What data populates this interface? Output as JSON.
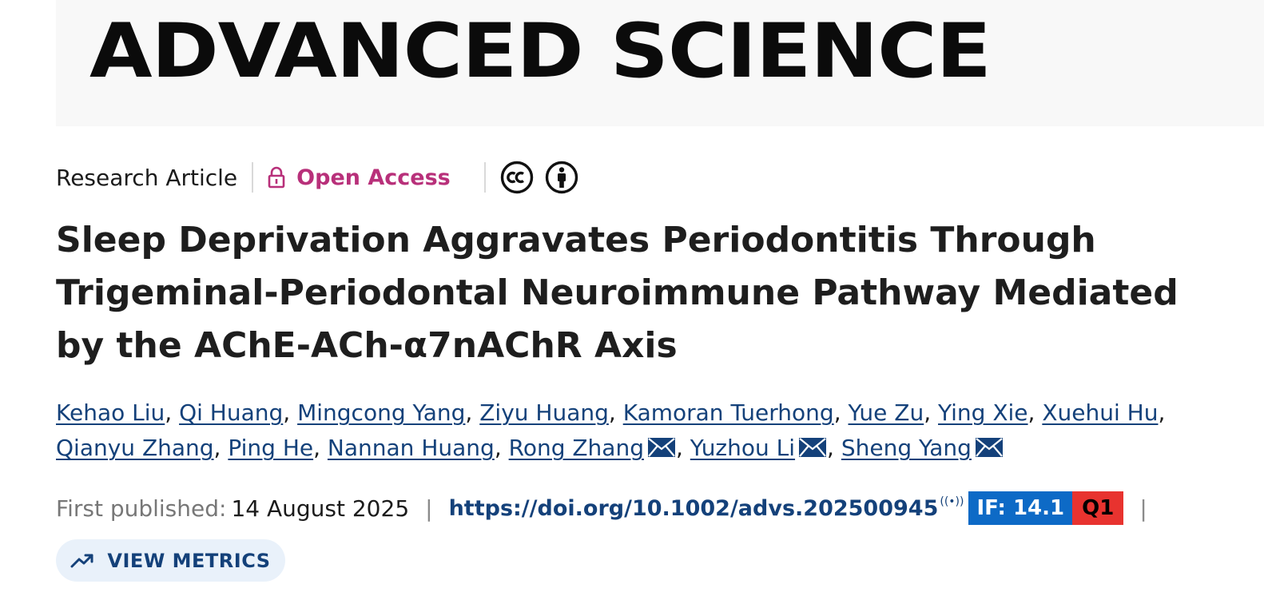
{
  "journal": {
    "name": "ADVANCED SCIENCE"
  },
  "meta": {
    "article_type": "Research Article",
    "access_label": "Open Access",
    "icons": [
      "lock-icon",
      "cc-icon",
      "cc-by-icon"
    ]
  },
  "title": "Sleep Deprivation Aggravates Periodontitis Through Trigeminal-Periodontal Neuroimmune Pathway Mediated by the AChE-ACh-α7nAChR Axis",
  "authors": [
    {
      "name": "Kehao Liu",
      "corresponding": false
    },
    {
      "name": "Qi Huang",
      "corresponding": false
    },
    {
      "name": "Mingcong Yang",
      "corresponding": false
    },
    {
      "name": "Ziyu Huang",
      "corresponding": false
    },
    {
      "name": "Kamoran Tuerhong",
      "corresponding": false
    },
    {
      "name": "Yue Zu",
      "corresponding": false
    },
    {
      "name": "Ying Xie",
      "corresponding": false
    },
    {
      "name": "Xuehui Hu",
      "corresponding": false
    },
    {
      "name": "Qianyu Zhang",
      "corresponding": false
    },
    {
      "name": "Ping He",
      "corresponding": false
    },
    {
      "name": "Nannan Huang",
      "corresponding": false
    },
    {
      "name": "Rong Zhang",
      "corresponding": true
    },
    {
      "name": "Yuzhou Li",
      "corresponding": true
    },
    {
      "name": "Sheng Yang",
      "corresponding": true
    }
  ],
  "publication": {
    "label": "First published:",
    "date": "14 August 2025",
    "doi": "https://doi.org/10.1002/advs.202500945",
    "signal_glyph": "((•))",
    "impact_factor": "IF: 14.1",
    "quartile": "Q1",
    "separator": "|"
  },
  "actions": {
    "metrics_label": "VIEW METRICS"
  },
  "colors": {
    "accent_open_access": "#b8307a",
    "link": "#14417a",
    "if_badge": "#0d6ac6",
    "quartile_badge": "#e8332f",
    "metrics_button_bg": "#e9f1fa"
  }
}
